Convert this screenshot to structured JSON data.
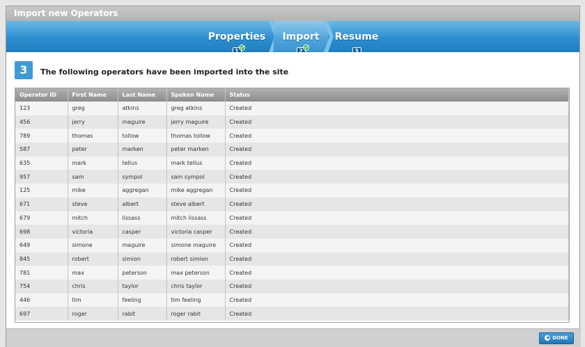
{
  "window": {
    "title": "Import new Operators"
  },
  "wizard": {
    "steps": [
      {
        "label": "Properties",
        "number": "1",
        "completed": true,
        "active": false
      },
      {
        "label": "Import",
        "number": "2",
        "completed": true,
        "active": true
      },
      {
        "label": "Resume",
        "number": "3",
        "completed": false,
        "active": false
      }
    ],
    "colors": {
      "bar": "#2d8fd0",
      "active": "#4ea3da"
    }
  },
  "content": {
    "step_number": "3",
    "heading": "The following operators have been imported into the site"
  },
  "table": {
    "columns": [
      "Operator ID",
      "First Name",
      "Last Name",
      "Spoken Name",
      "Status"
    ],
    "rows": [
      [
        "123",
        "greg",
        "atkins",
        "greg atkins",
        "Created"
      ],
      [
        "456",
        "jerry",
        "maguire",
        "jerry maguire",
        "Created"
      ],
      [
        "789",
        "thomas",
        "tollow",
        "thomas tollow",
        "Created"
      ],
      [
        "587",
        "peter",
        "marken",
        "peter marken",
        "Created"
      ],
      [
        "635",
        "mark",
        "tellus",
        "mark tellus",
        "Created"
      ],
      [
        "957",
        "sam",
        "sympol",
        "sam sympol",
        "Created"
      ],
      [
        "125",
        "mike",
        "aggregan",
        "mike aggregan",
        "Created"
      ],
      [
        "671",
        "steve",
        "albert",
        "steve albert",
        "Created"
      ],
      [
        "679",
        "mitch",
        "lissass",
        "mitch lissass",
        "Created"
      ],
      [
        "698",
        "victoria",
        "casper",
        "victoria casper",
        "Created"
      ],
      [
        "649",
        "simone",
        "maguire",
        "simone maguire",
        "Created"
      ],
      [
        "845",
        "robert",
        "simion",
        "robert simion",
        "Created"
      ],
      [
        "781",
        "max",
        "peterson",
        "max peterson",
        "Created"
      ],
      [
        "754",
        "chris",
        "taylor",
        "chris taylor",
        "Created"
      ],
      [
        "446",
        "tim",
        "feeling",
        "tim feeling",
        "Created"
      ],
      [
        "697",
        "roger",
        "rabit",
        "roger rabit",
        "Created"
      ]
    ]
  },
  "footer": {
    "done_label": "DONE",
    "done_icon": "arrow-left-icon"
  }
}
